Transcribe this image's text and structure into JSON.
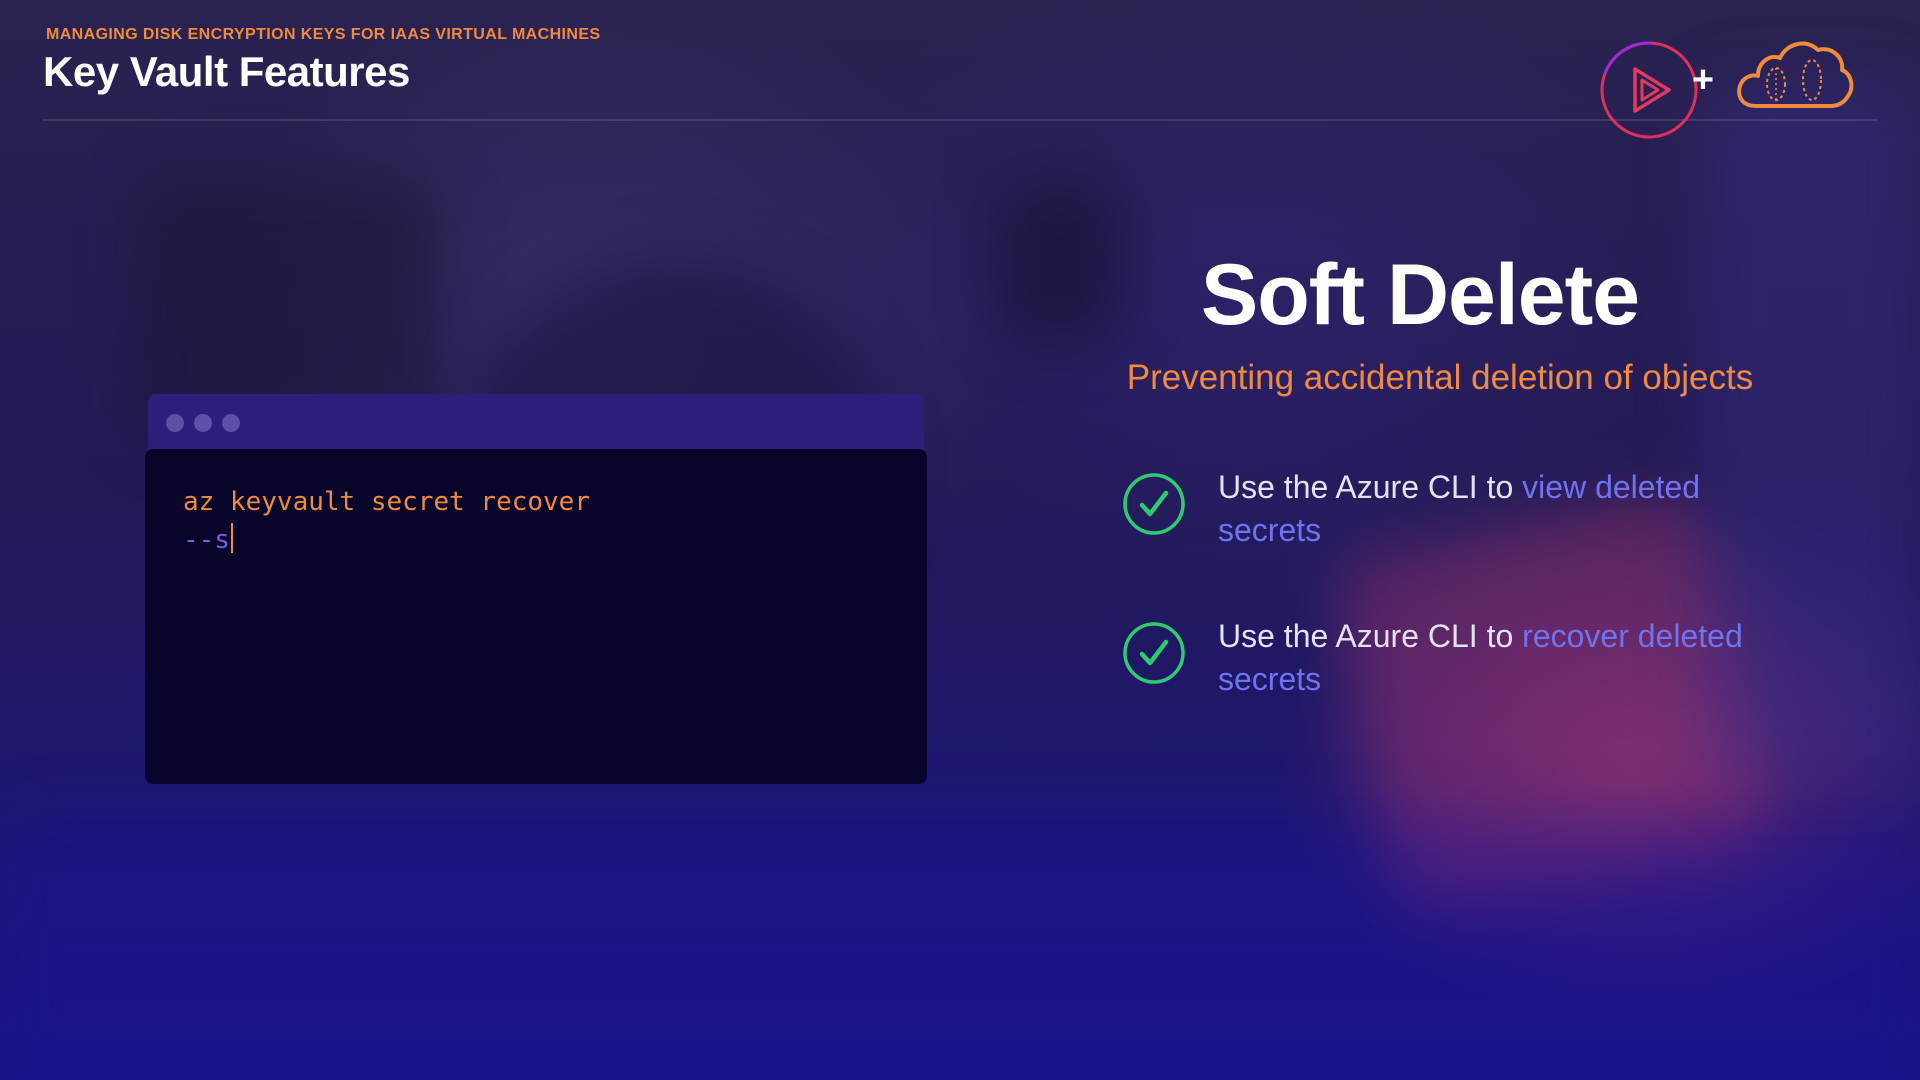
{
  "header": {
    "kicker": "MANAGING DISK ENCRYPTION KEYS FOR IAAS VIRTUAL MACHINES",
    "title": "Key Vault Features",
    "logos": {
      "left_icon": "play-logo-icon",
      "separator": "+",
      "right_icon": "cloud-logo-icon"
    }
  },
  "terminal": {
    "line1": "az keyvault secret recover",
    "line2": "--s"
  },
  "slide": {
    "title": "Soft Delete",
    "subtitle": "Preventing accidental deletion of objects",
    "bullets": [
      {
        "icon": "check-circle-icon",
        "prefix": "Use the Azure CLI to ",
        "link": "view deleted secrets"
      },
      {
        "icon": "check-circle-icon",
        "prefix": "Use the Azure CLI to ",
        "link": "recover deleted secrets"
      }
    ]
  },
  "colors": {
    "accent_orange": "#f08a3c",
    "link_blue": "#6f73f0",
    "check_green": "#2ecc71",
    "terminal_bg": "#07052a",
    "terminal_bar": "#2a1f7a"
  }
}
